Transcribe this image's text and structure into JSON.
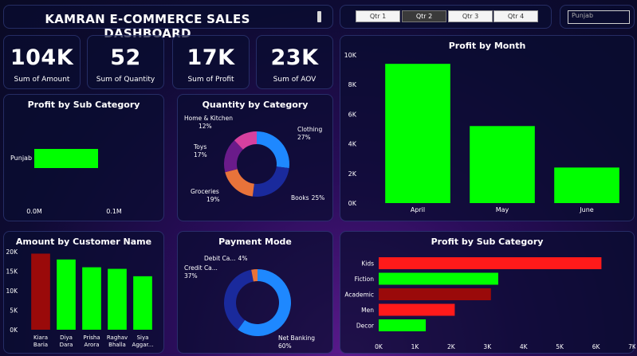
{
  "header": {
    "title": "KAMRAN E-COMMERCE SALES DASHBOARD"
  },
  "quarters": [
    "Qtr 1",
    "Qtr 2",
    "Qtr 3",
    "Qtr 4"
  ],
  "active_quarter": "Qtr 2",
  "state_filter": {
    "value": "Punjab"
  },
  "kpis": [
    {
      "value": "104K",
      "label": "Sum of Amount"
    },
    {
      "value": "52",
      "label": "Sum of Quantity"
    },
    {
      "value": "17K",
      "label": "Sum of Profit"
    },
    {
      "value": "23K",
      "label": "Sum of AOV"
    }
  ],
  "colors": {
    "green": "#00ff00",
    "red": "#ff1a1a",
    "dark_red": "#9a0a0a",
    "blue": "#1e88ff",
    "navy": "#1a2a9c"
  },
  "chart_data": [
    {
      "id": "profit_by_month",
      "type": "bar",
      "title": "Profit by Month",
      "categories": [
        "April",
        "May",
        "June"
      ],
      "values": [
        9400,
        5200,
        2400
      ],
      "y_ticks": [
        "0K",
        "2K",
        "4K",
        "6K",
        "8K",
        "10K"
      ],
      "ylim": [
        0,
        10000
      ],
      "color": "#00ff00"
    },
    {
      "id": "profit_by_subcat_state",
      "type": "bar",
      "orientation": "horizontal",
      "title": "Profit by Sub Category",
      "categories": [
        "Punjab"
      ],
      "values": [
        0.08
      ],
      "x_ticks": [
        "0.0M",
        "0.1M"
      ],
      "xlim": [
        0,
        0.1
      ],
      "color": "#00ff00"
    },
    {
      "id": "quantity_by_category",
      "type": "pie",
      "variant": "donut",
      "title": "Quantity by Category",
      "slices": [
        {
          "name": "Clothing",
          "pct": 27,
          "label_pct": "27%",
          "color": "#1e88ff"
        },
        {
          "name": "Books",
          "pct": 25,
          "label_pct": "25%",
          "color": "#1a2a9c"
        },
        {
          "name": "Groceries",
          "pct": 19,
          "label_pct": "19%",
          "color": "#e8733a"
        },
        {
          "name": "Toys",
          "pct": 17,
          "label_pct": "17%",
          "color": "#6a1b8a"
        },
        {
          "name": "Home & Kitchen",
          "pct": 12,
          "label_pct": "12%",
          "color": "#d6409f"
        }
      ]
    },
    {
      "id": "amount_by_customer",
      "type": "bar",
      "title": "Amount by Customer Name",
      "categories": [
        "Kiara Baria",
        "Diya Dara",
        "Prisha Arora",
        "Raghav Bhalla",
        "Siya Aggar..."
      ],
      "category_lines": [
        [
          "Kiara",
          "Baria"
        ],
        [
          "Diya",
          "Dara"
        ],
        [
          "Prisha",
          "Arora"
        ],
        [
          "Raghav",
          "Bhalla"
        ],
        [
          "Siya",
          "Aggar..."
        ]
      ],
      "values": [
        19500,
        18000,
        16000,
        15600,
        13700
      ],
      "colors": [
        "#9a0a0a",
        "#00ff00",
        "#00ff00",
        "#00ff00",
        "#00ff00"
      ],
      "y_ticks": [
        "0K",
        "5K",
        "10K",
        "15K",
        "20K"
      ],
      "ylim": [
        0,
        20000
      ]
    },
    {
      "id": "payment_mode",
      "type": "pie",
      "variant": "donut",
      "title": "Payment Mode",
      "slices": [
        {
          "name": "Net Banking",
          "pct": 60,
          "label": "Net Banking",
          "label_pct": "60%",
          "color": "#1e88ff"
        },
        {
          "name": "Credit Ca...",
          "pct": 37,
          "label": "Credit Ca...",
          "label_pct": "37%",
          "color": "#1a2a9c"
        },
        {
          "name": "Debit Ca...",
          "pct": 3,
          "label": "Debit Ca...",
          "label_pct": "4%",
          "color": "#e8733a"
        }
      ]
    },
    {
      "id": "profit_by_subcategory",
      "type": "bar",
      "orientation": "horizontal",
      "title": "Profit by Sub Category",
      "categories": [
        "Kids",
        "Fiction",
        "Academic",
        "Men",
        "Decor"
      ],
      "values": [
        6150,
        3300,
        3100,
        2100,
        1300
      ],
      "colors": [
        "#ff1a1a",
        "#00ff00",
        "#9a0a0a",
        "#ff1a1a",
        "#00ff00"
      ],
      "x_ticks": [
        "0K",
        "1K",
        "2K",
        "3K",
        "4K",
        "5K",
        "6K",
        "7K"
      ],
      "xlim": [
        0,
        7000
      ]
    }
  ]
}
